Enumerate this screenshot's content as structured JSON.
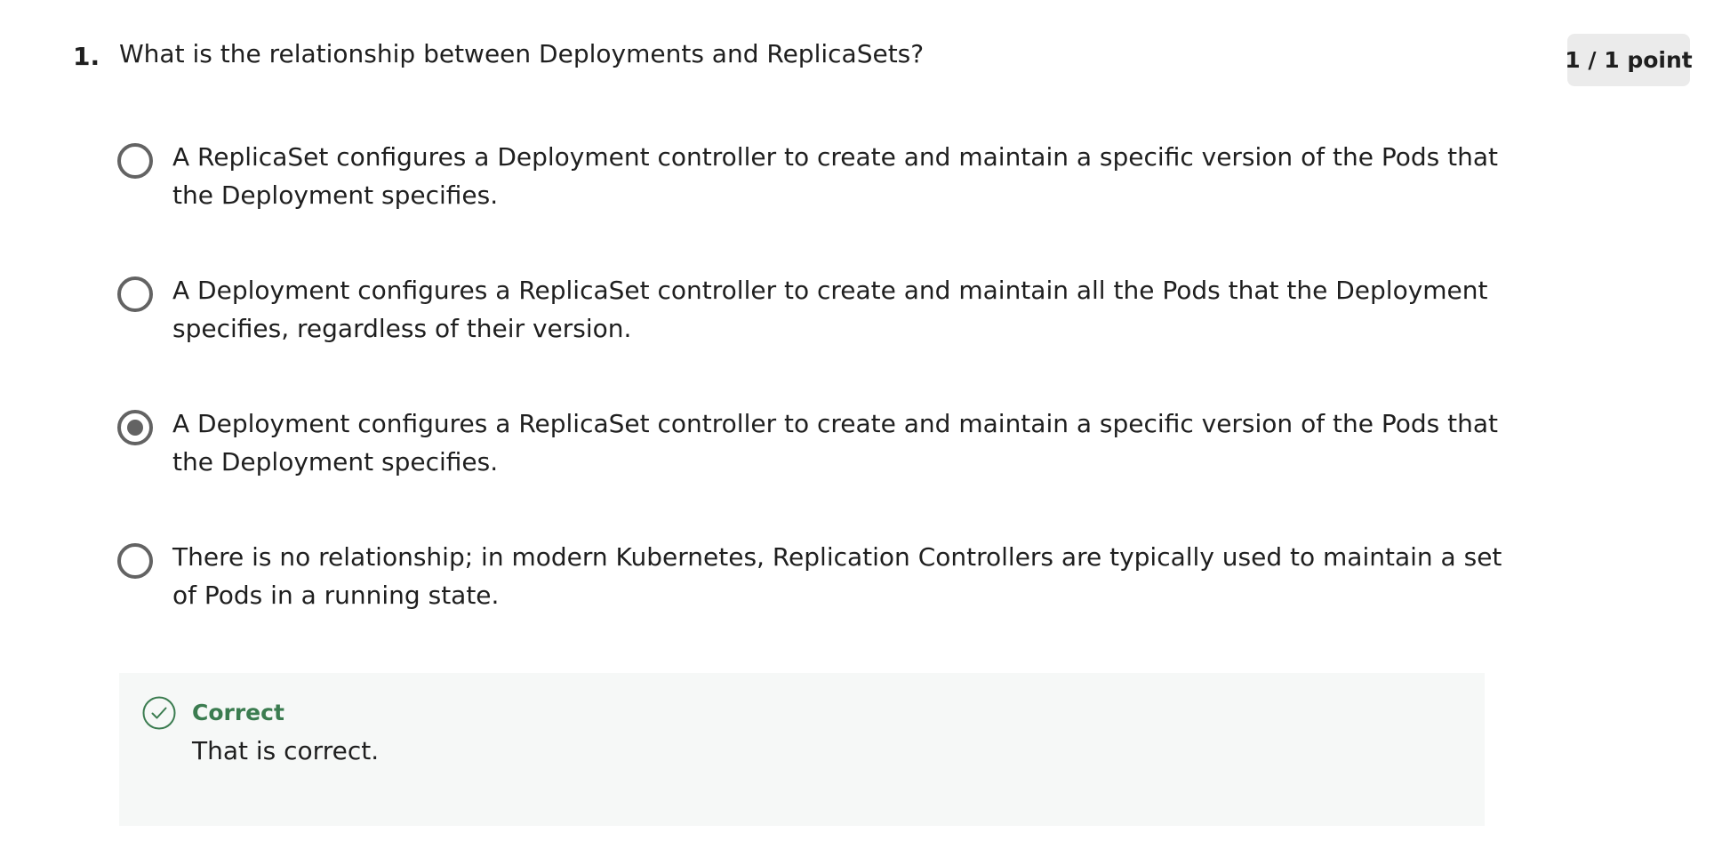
{
  "question": {
    "number": "1.",
    "text": "What is the relationship between Deployments and ReplicaSets?",
    "score": "1 / 1 point"
  },
  "options": [
    {
      "text": "A ReplicaSet configures a Deployment controller to create and maintain a specific version of the Pods that the Deployment specifies.",
      "selected": false
    },
    {
      "text": "A Deployment configures a ReplicaSet controller to create and maintain all the Pods that the Deployment specifies, regardless of their version.",
      "selected": false
    },
    {
      "text": "A Deployment configures a ReplicaSet controller to create and maintain a specific version of the Pods that the Deployment specifies.",
      "selected": true
    },
    {
      "text": "There is no relationship; in modern Kubernetes, Replication Controllers are typically used to maintain a set of Pods in a running state.",
      "selected": false
    }
  ],
  "feedback": {
    "icon": "check-circle-icon",
    "title": "Correct",
    "text": "That is correct."
  },
  "colors": {
    "radio_border": "#636363",
    "feedback_bg": "#f6f8f7",
    "correct_green": "#3b7c50",
    "badge_bg": "#ebebeb"
  }
}
